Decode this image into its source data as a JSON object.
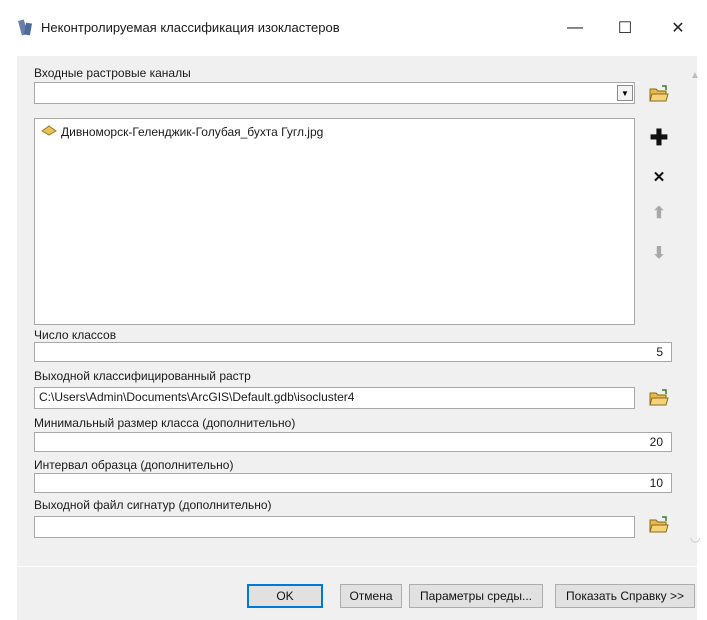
{
  "window": {
    "title": "Неконтролируемая классификация изокластеров",
    "minimize": "—",
    "maximize": "☐",
    "close": "✕"
  },
  "form": {
    "input_bands": {
      "label": "Входные растровые каналы",
      "value": "",
      "items": [
        "Дивноморск-Геленджик-Голубая_бухта Гугл.jpg"
      ]
    },
    "num_classes": {
      "label": "Число классов",
      "value": "5"
    },
    "output_raster": {
      "label": "Выходной классифицированный растр",
      "value": "C:\\Users\\Admin\\Documents\\ArcGIS\\Default.gdb\\isocluster4"
    },
    "min_class_size": {
      "label": "Минимальный размер класса (дополнительно)",
      "value": "20"
    },
    "sample_interval": {
      "label": "Интервал образца (дополнительно)",
      "value": "10"
    },
    "output_signature": {
      "label": "Выходной файл сигнатур (дополнительно)",
      "value": ""
    }
  },
  "buttons": {
    "ok": "OK",
    "cancel": "Отмена",
    "env": "Параметры среды...",
    "help": "Показать Справку >>"
  }
}
